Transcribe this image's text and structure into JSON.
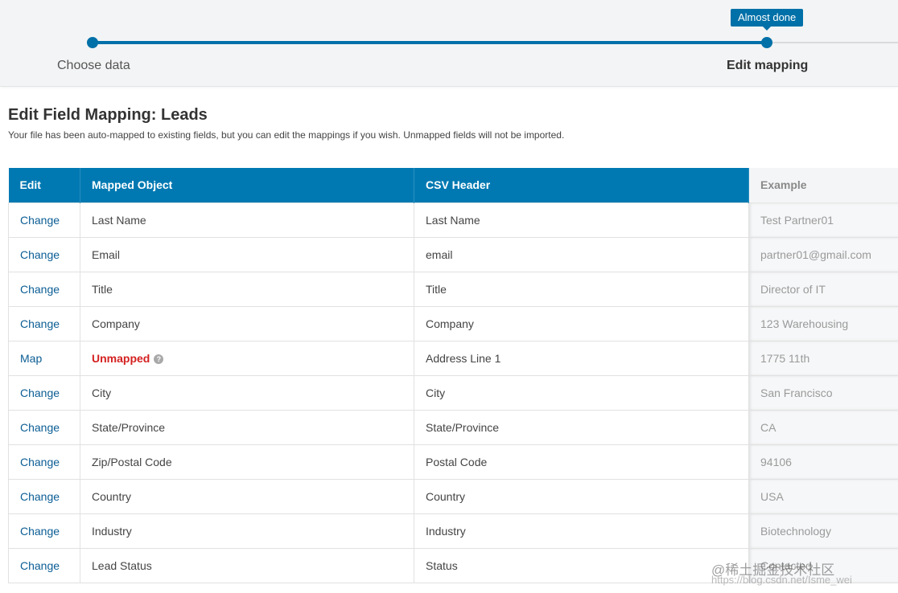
{
  "wizard": {
    "steps": [
      {
        "label": "Choose data"
      },
      {
        "label": "Edit mapping"
      }
    ],
    "tooltip": "Almost done"
  },
  "header": {
    "title": "Edit Field Mapping: Leads",
    "description": "Your file has been auto-mapped to existing fields, but you can edit the mappings if you wish. Unmapped fields will not be imported."
  },
  "table": {
    "columns": [
      "Edit",
      "Mapped Object",
      "CSV Header",
      "Example"
    ],
    "rows": [
      {
        "edit": "Change",
        "mapped": "Last Name",
        "csv": "Last Name",
        "example": "Test Partner01"
      },
      {
        "edit": "Change",
        "mapped": "Email",
        "csv": "email",
        "example": "partner01@gmail.com"
      },
      {
        "edit": "Change",
        "mapped": "Title",
        "csv": "Title",
        "example": "Director of IT"
      },
      {
        "edit": "Change",
        "mapped": "Company",
        "csv": "Company",
        "example": "123 Warehousing"
      },
      {
        "edit": "Map",
        "mapped": "Unmapped",
        "csv": "Address Line 1",
        "example": "1775 11th",
        "unmapped": true
      },
      {
        "edit": "Change",
        "mapped": "City",
        "csv": "City",
        "example": "San Francisco"
      },
      {
        "edit": "Change",
        "mapped": "State/Province",
        "csv": "State/Province",
        "example": "CA"
      },
      {
        "edit": "Change",
        "mapped": "Zip/Postal Code",
        "csv": "Postal Code",
        "example": "94106"
      },
      {
        "edit": "Change",
        "mapped": "Country",
        "csv": "Country",
        "example": "USA"
      },
      {
        "edit": "Change",
        "mapped": "Industry",
        "csv": "Industry",
        "example": "Biotechnology"
      },
      {
        "edit": "Change",
        "mapped": "Lead Status",
        "csv": "Status",
        "example": "Contacted"
      }
    ]
  },
  "watermark": {
    "text": "@稀土掘金技术社区",
    "url": "https://blog.csdn.net/Isme_wei"
  },
  "colors": {
    "accent": "#0079b2",
    "link": "#0b5d94",
    "unmapped": "#d42020"
  }
}
